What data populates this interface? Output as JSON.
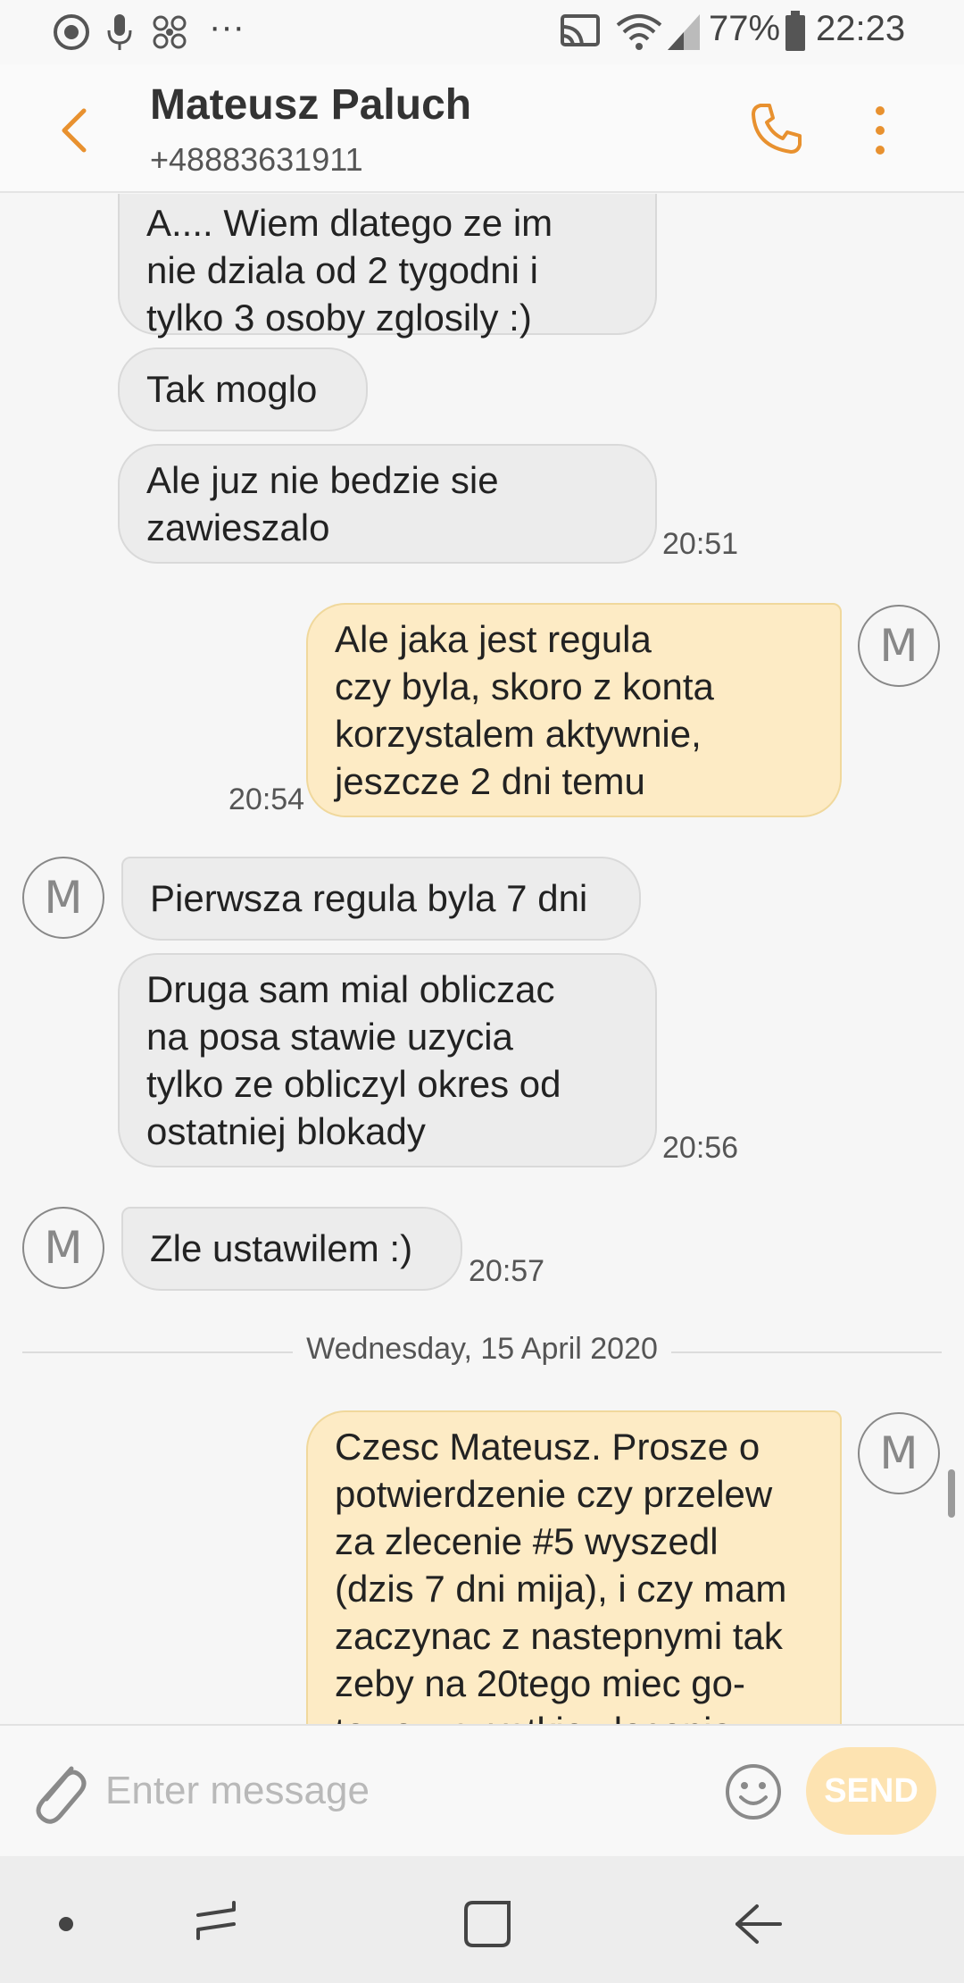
{
  "status_bar": {
    "battery": "77%",
    "time": "22:23",
    "more_label": "···"
  },
  "header": {
    "contact_name": "Mateusz Paluch",
    "contact_number": "+48883631911"
  },
  "messages": [
    {
      "dir": "in",
      "text": "A.... Wiem dlatego ze im\nnie dziala od 2 tygodni i\ntylko 3 osoby zglosily :)"
    },
    {
      "dir": "in",
      "text": "Tak moglo"
    },
    {
      "dir": "in",
      "text": "Ale juz nie bedzie sie\nzawieszalo",
      "time": "20:51"
    },
    {
      "dir": "out",
      "avatar": "M",
      "text": "Ale jaka jest regula\nczy byla, skoro z konta\nkorzystalem aktywnie,\njeszcze 2 dni temu",
      "time": "20:54"
    },
    {
      "dir": "in",
      "avatar": "M",
      "text": "Pierwsza regula byla 7 dni"
    },
    {
      "dir": "in",
      "text": "Druga sam mial obliczac\nna posa stawie uzycia\ntylko ze obliczyl okres od\nostatniej blokady",
      "time": "20:56"
    },
    {
      "dir": "in",
      "avatar": "M",
      "text": "Zle ustawilem :)",
      "time": "20:57"
    },
    {
      "dir": "out",
      "avatar": "M",
      "text": "Czesc Mateusz. Prosze o\npotwierdzenie czy przelew\nza zlecenie #5 wyszedl\n(dzis 7 dni mija), i czy mam\nzaczynac z nastepnymi tak\nzeby na 20tego miec go-\ntowe wszystkie zlecenia"
    }
  ],
  "date_separator": "Wednesday, 15 April 2020",
  "composer": {
    "placeholder": "Enter message",
    "send_label": "SEND"
  },
  "colors": {
    "accent": "#e8912f",
    "incoming_bubble": "#ececec",
    "outgoing_bubble": "#fdebc5",
    "send_button": "#fde3b1"
  },
  "icons": {
    "back": "back-arrow-icon",
    "call": "phone-icon",
    "menu": "more-vert-icon",
    "attach": "paperclip-icon",
    "emoji": "smiley-icon"
  }
}
